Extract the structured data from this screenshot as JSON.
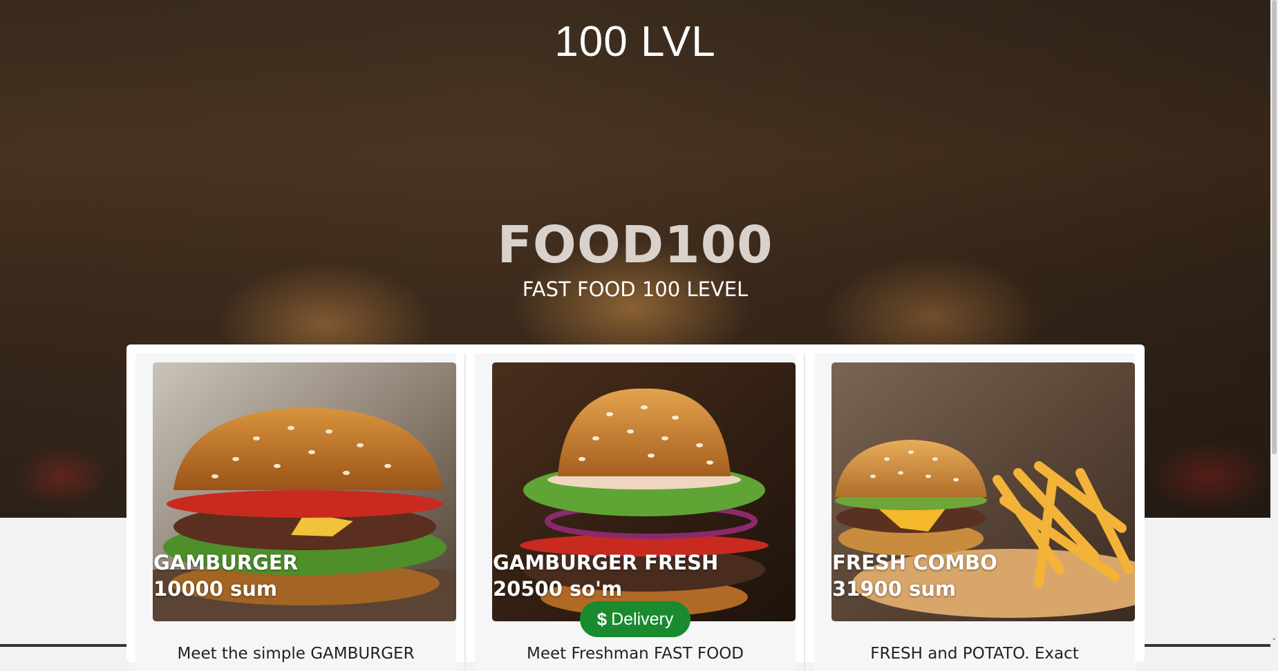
{
  "header": {
    "title": "100 LVL",
    "brand": "FOOD100",
    "tagline": "FAST FOOD 100 LEVEL"
  },
  "products": [
    {
      "name": "GAMBURGER",
      "price": "10000 sum",
      "description": "Meet the simple GAMBURGER"
    },
    {
      "name": "GAMBURGER FRESH",
      "price": "20500 so'm",
      "description": "Meet Freshman FAST FOOD"
    },
    {
      "name": "FRESH COMBO",
      "price": "31900 sum",
      "description": "FRESH and POTATO. Exact"
    }
  ],
  "delivery": {
    "label": "Delivery",
    "icon": "dollar-icon"
  },
  "colors": {
    "accent": "#1a8a2e",
    "panel": "#ffffff",
    "card": "#f5f6f8"
  }
}
